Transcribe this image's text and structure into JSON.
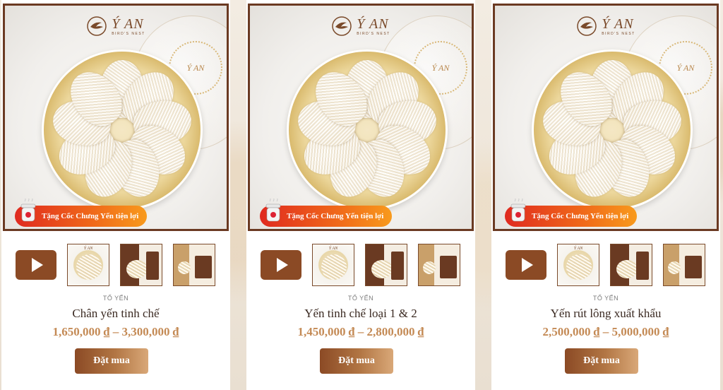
{
  "brand": {
    "name": "Ý AN",
    "tagline": "BIRD'S NEST",
    "seal_text": "Ý AN"
  },
  "promo_badge": "Tặng Cốc Chưng Yến tiện lợi",
  "products": [
    {
      "category": "TỔ YẾN",
      "name": "Chân yến tinh chế",
      "price": "1,650,000 ₫ – 3,300,000 ₫",
      "buy_label": "Đặt mua"
    },
    {
      "category": "TỔ YẾN",
      "name": "Yến tinh chế loại 1 & 2",
      "price": "1,450,000 ₫ – 2,800,000 ₫",
      "buy_label": "Đặt mua"
    },
    {
      "category": "TỔ YẾN",
      "name": "Yến rút lông xuất khẩu",
      "price": "2,500,000 ₫ – 5,000,000 ₫",
      "buy_label": "Đặt mua"
    }
  ],
  "icons": {
    "play": "play-icon",
    "logo": "bird-logo-icon",
    "cup": "steaming-cup-icon"
  },
  "colors": {
    "frame": "#6b3a22",
    "price": "#c48a55",
    "button_start": "#8b4a25",
    "badge_start": "#e02a1f",
    "badge_end": "#f89a1c"
  }
}
